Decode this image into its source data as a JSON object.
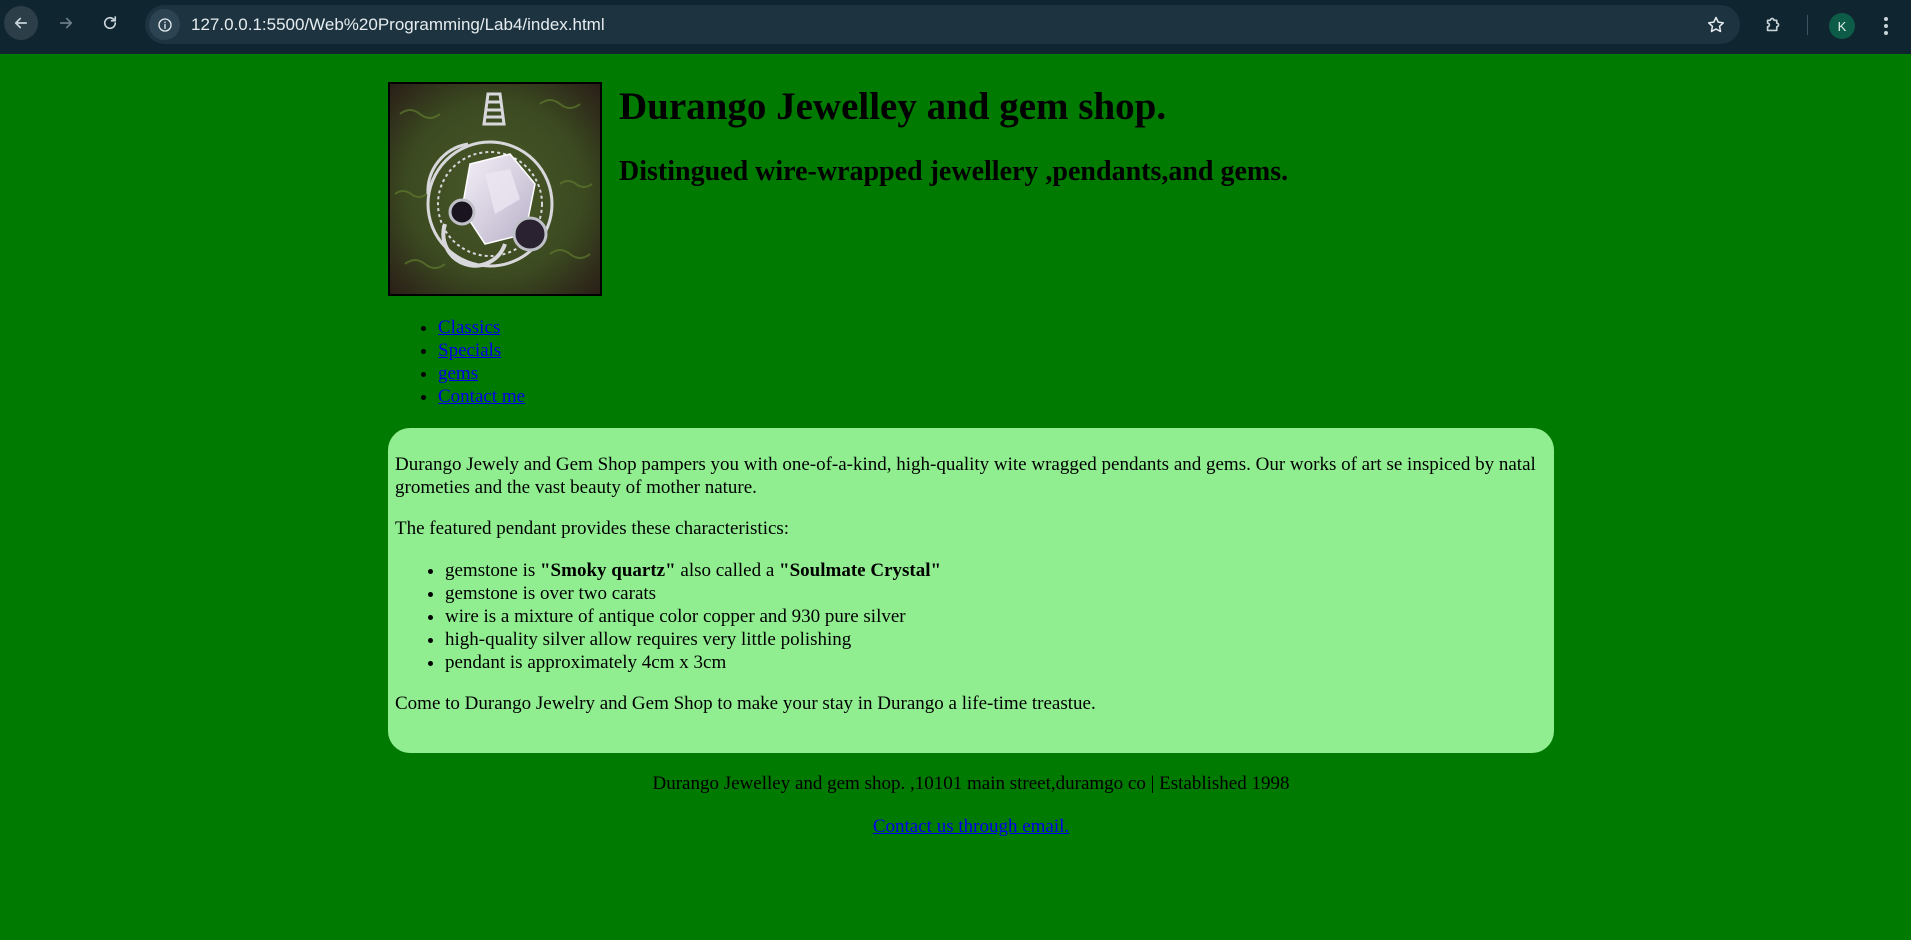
{
  "browser": {
    "url": "127.0.0.1:5500/Web%20Programming/Lab4/index.html",
    "profile_initial": "K"
  },
  "header": {
    "title": "Durango Jewelley and gem shop.",
    "subtitle": "Distingued wire-wrapped jewellery ,pendants,and gems."
  },
  "nav": {
    "items": [
      {
        "label": "Classics"
      },
      {
        "label": "Specials"
      },
      {
        "label": "gems"
      },
      {
        "label": "Contact me"
      }
    ]
  },
  "content": {
    "intro": "Durango Jewely and Gem Shop pampers you with one-of-a-kind, high-quality wite wragged pendants and gems. Our works of art se inspiced by natal grometies and the vast beauty of mother nature.",
    "features_lead": "The featured pendant provides these characteristics:",
    "feature_1": {
      "prefix": "gemstone is ",
      "bold1": "\"Smoky quartz\"",
      "middle": " also called a ",
      "bold2": "\"Soulmate Crystal\""
    },
    "features": [
      "gemstone is over two carats",
      "wire is a mixture of antique color copper and 930 pure silver",
      "high-quality silver allow requires very little polishing",
      "pendant is approximately 4cm x 3cm"
    ],
    "closing": "Come to Durango Jewelry and Gem Shop to make your stay in Durango a life-time treastue."
  },
  "footer": {
    "address": "Durango Jewelley and gem shop. ,10101 main street,duramgo co | Established 1998",
    "email_link": "Contact us through email."
  },
  "colors": {
    "page_bg": "#007a00",
    "content_bg": "#90ee90",
    "link": "#0000ee"
  }
}
